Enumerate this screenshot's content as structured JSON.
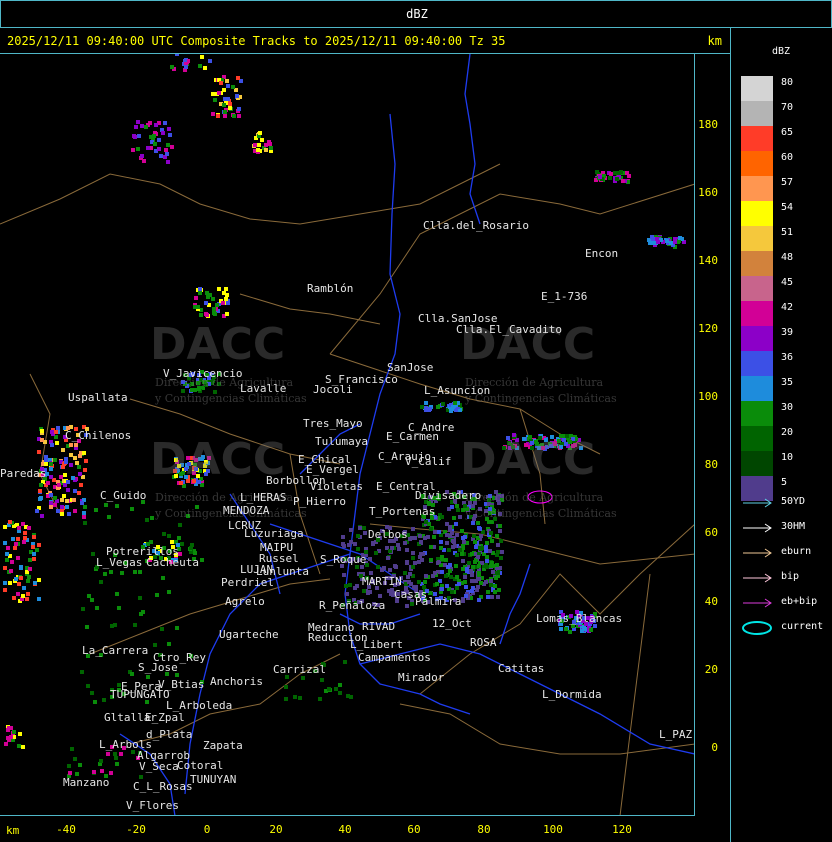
{
  "header": {
    "title": "dBZ"
  },
  "subheader": {
    "text": "2025/12/11 09:40:00 UTC Composite Tracks to 2025/12/11 09:40:00 Tz 35",
    "unit": "km"
  },
  "axes": {
    "unit": "km",
    "y_ticks": [
      "180",
      "160",
      "140",
      "120",
      "100",
      "80",
      "60",
      "40",
      "20",
      "0"
    ],
    "x_ticks": [
      "-40",
      "-20",
      "0",
      "20",
      "40",
      "60",
      "80",
      "100",
      "120"
    ]
  },
  "places": [
    "Clla.del_Rosario",
    "Encon",
    "E_1-736",
    "Ramblón",
    "Clla.SanJose",
    "Clla.El_Cavadito",
    "S_Francisco",
    "Jocoli",
    "SanJose",
    "L_Asuncion",
    "V_Javicencio",
    "Lavalle",
    "Uspallata",
    "Tres_Mayo",
    "Tulumaya",
    "C_Andre",
    "E_Carmen",
    "C_Chilenos",
    "E_Chical",
    "E_Vergel",
    "C_Araujo",
    "V_Calif",
    "Borbollon",
    "Violetas",
    "E_Central",
    "Divisadero",
    "C_Guido",
    "L_HERAS",
    "P_Hierro",
    "MENDOZA",
    "LCRUZ",
    "T_Portenas",
    "Luzuriaga",
    "MAIPU",
    "Russel",
    "Potrerillos",
    "Cacheuta",
    "L_Vegas",
    "LUJAN",
    "Lunlunta",
    "Perdriel",
    "Agrelo",
    "R_Peñaloza",
    "RIVAD",
    "MARTIN",
    "Palmira",
    "Medrano",
    "Reduccion",
    "L_Libert",
    "12_Oct",
    "ROSA",
    "Campamentos",
    "Catitas",
    "Lomas_Blancas",
    "L_Dormida",
    "Mirador",
    "Ugarteche",
    "La_Carrera",
    "Ctro_Rey",
    "S_Jose",
    "Carrizal",
    "Anchoris",
    "E_Pera",
    "TUPUNGATO",
    "V_Btias",
    "L_Arboleda",
    "Gltallar",
    "E_Zpal",
    "d_Plata",
    "Zapata",
    "L_Arbols",
    "Algarrob",
    "V_Seca",
    "Cotoral",
    "Manzano",
    "C_L_Rosas",
    "TUNUYAN",
    "V_Flores",
    "L_PAZ",
    "Paredas",
    "Delbos",
    "S_Roque",
    "Casas"
  ],
  "watermark": {
    "brand": "DACC",
    "line1": "Dirección de Agricultura",
    "line2": "y Contingencias Climáticas"
  },
  "legend": {
    "title": "dBZ",
    "levels": [
      {
        "label": "80",
        "color": "#d4d4d4"
      },
      {
        "label": "70",
        "color": "#b4b4b4"
      },
      {
        "label": "65",
        "color": "#ff3c28"
      },
      {
        "label": "60",
        "color": "#ff6400"
      },
      {
        "label": "57",
        "color": "#ff9650"
      },
      {
        "label": "54",
        "color": "#ffff00"
      },
      {
        "label": "51",
        "color": "#f5c83c"
      },
      {
        "label": "48",
        "color": "#d2823c"
      },
      {
        "label": "45",
        "color": "#c8648c"
      },
      {
        "label": "42",
        "color": "#d20096"
      },
      {
        "label": "39",
        "color": "#8c00c8"
      },
      {
        "label": "36",
        "color": "#3c50e6"
      },
      {
        "label": "35",
        "color": "#1e8cdc"
      },
      {
        "label": "30",
        "color": "#0a8c0a"
      },
      {
        "label": "20",
        "color": "#006400"
      },
      {
        "label": "10",
        "color": "#004600"
      },
      {
        "label": "5",
        "color": "#503c8c"
      }
    ],
    "tracks": [
      {
        "label": "50YD",
        "color": "#5fd2e6"
      },
      {
        "label": "30HM",
        "color": "#ffffff"
      },
      {
        "label": "eburn",
        "color": "#f0c896"
      },
      {
        "label": "bip",
        "color": "#ffc8dc"
      },
      {
        "label": "eb+bip",
        "color": "#dc3cdc"
      },
      {
        "label": "current",
        "color": "#00e6e6"
      }
    ]
  }
}
